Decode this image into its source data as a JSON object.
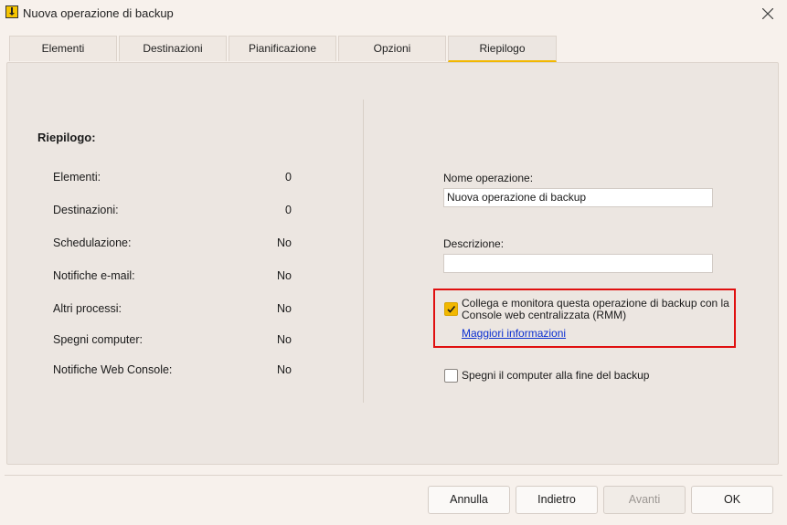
{
  "window": {
    "title": "Nuova operazione di backup",
    "app_icon": "app-icon",
    "close_icon": "close-icon"
  },
  "tabs": [
    {
      "label": "Elementi"
    },
    {
      "label": "Destinazioni"
    },
    {
      "label": "Pianificazione"
    },
    {
      "label": "Opzioni"
    },
    {
      "label": "Riepilogo",
      "active": true
    }
  ],
  "summary": {
    "title": "Riepilogo:",
    "rows": [
      {
        "label": "Elementi:",
        "value": "0"
      },
      {
        "label": "Destinazioni:",
        "value": "0"
      },
      {
        "label": "Schedulazione:",
        "value": "No"
      },
      {
        "label": "Notifiche e-mail:",
        "value": "No"
      },
      {
        "label": "Altri processi:",
        "value": "No"
      },
      {
        "label": "Spegni computer:",
        "value": "No"
      },
      {
        "label": "Notifiche Web Console:",
        "value": "No"
      }
    ]
  },
  "form": {
    "name_label": "Nome operazione:",
    "name_value": "Nuova operazione di backup",
    "description_label": "Descrizione:",
    "description_value": "",
    "rmm_checkbox": {
      "checked": true,
      "label_line1": "Collega e monitora questa operazione di backup con la",
      "label_line2": "Console web centralizzata (RMM)",
      "link": "Maggiori informazioni"
    },
    "shutdown_checkbox": {
      "checked": false,
      "label": "Spegni il computer alla fine del backup"
    }
  },
  "buttons": {
    "cancel": "Annulla",
    "back": "Indietro",
    "next": "Avanti",
    "ok": "OK"
  },
  "colors": {
    "accent": "#f2b800",
    "highlight_border": "#e01010",
    "link": "#0b2fd1"
  }
}
